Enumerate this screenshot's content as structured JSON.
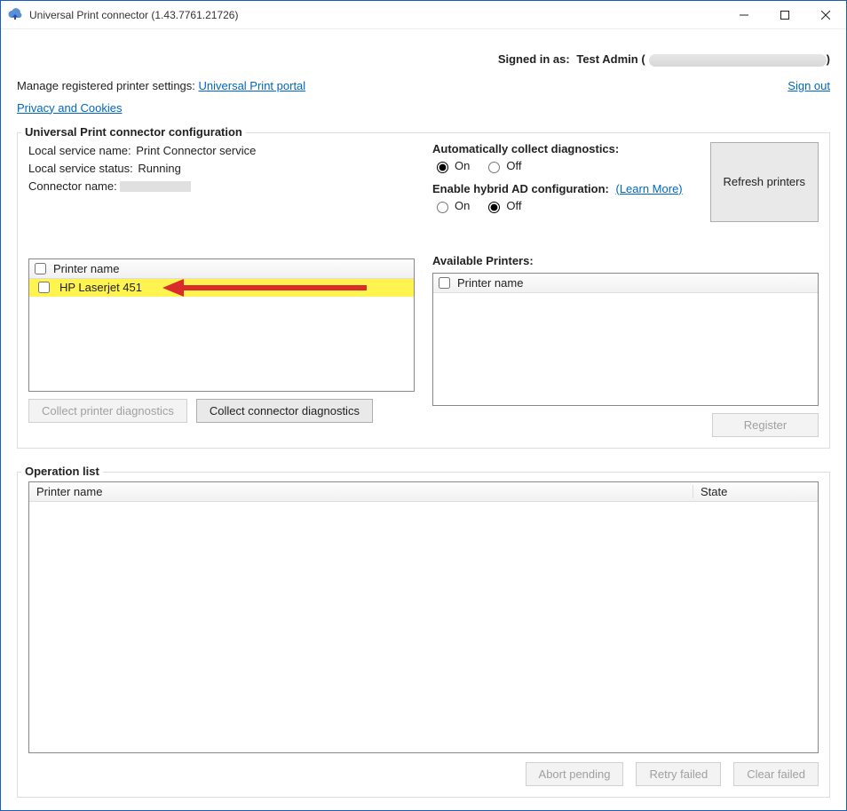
{
  "window": {
    "title": "Universal Print connector (1.43.7761.21726)"
  },
  "header": {
    "signed_in_prefix": "Signed in as:",
    "signed_in_user": "Test Admin",
    "manage_text": "Manage registered printer settings:",
    "portal_link": "Universal Print portal",
    "sign_out": "Sign out",
    "privacy_link": "Privacy and Cookies"
  },
  "config": {
    "legend": "Universal Print connector configuration",
    "local_service_name_label": "Local service name:",
    "local_service_name_value": "Print Connector service",
    "local_service_status_label": "Local service status:",
    "local_service_status_value": "Running",
    "connector_name_label": "Connector name:",
    "auto_diag_title": "Automatically collect diagnostics:",
    "hybrid_title": "Enable hybrid AD configuration:",
    "learn_more": "(Learn More)",
    "on_label": "On",
    "off_label": "Off",
    "auto_diag_value": "On",
    "hybrid_value": "Off",
    "refresh_btn": "Refresh printers",
    "available_heading": "Available Printers:",
    "col_printer_name": "Printer name",
    "registered_printers": [
      {
        "name": "HP Laserjet 451",
        "highlighted": true
      }
    ],
    "available_printers": [],
    "collect_printer_btn": "Collect printer diagnostics",
    "collect_connector_btn": "Collect connector diagnostics",
    "register_btn": "Register"
  },
  "oplist": {
    "legend": "Operation list",
    "col_printer_name": "Printer name",
    "col_state": "State",
    "rows": [],
    "abort_btn": "Abort pending",
    "retry_btn": "Retry failed",
    "clear_btn": "Clear failed"
  }
}
